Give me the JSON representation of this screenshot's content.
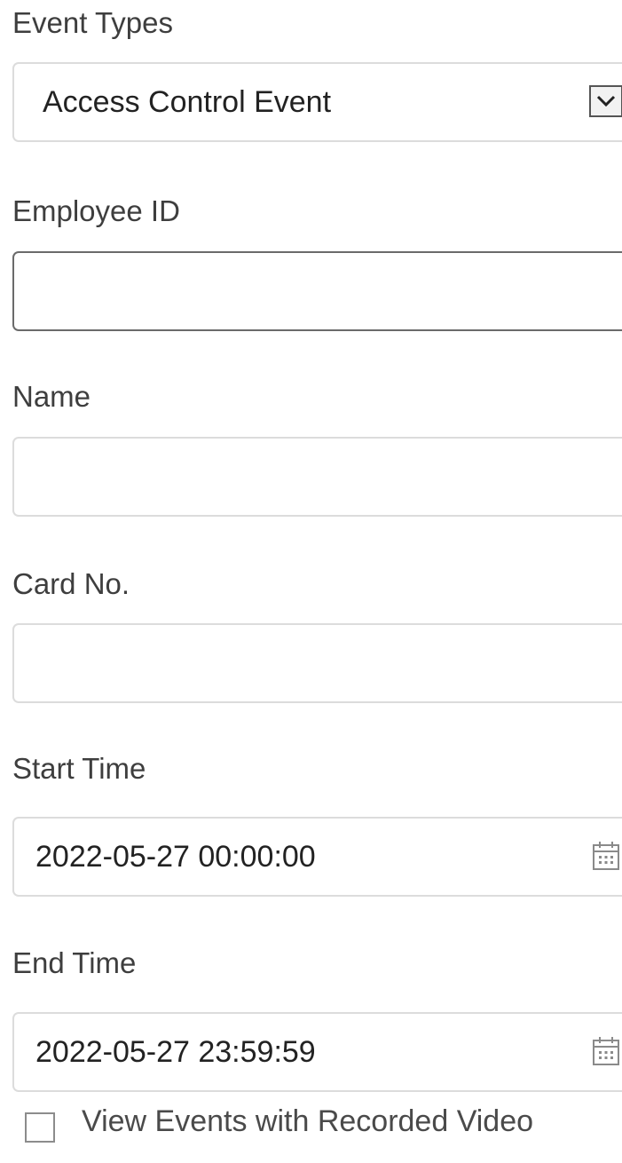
{
  "event_types": {
    "label": "Event Types",
    "selected": "Access Control Event",
    "icon": "chevron-down-icon"
  },
  "employee_id": {
    "label": "Employee ID",
    "value": ""
  },
  "name": {
    "label": "Name",
    "value": ""
  },
  "card_no": {
    "label": "Card No.",
    "value": ""
  },
  "start_time": {
    "label": "Start Time",
    "value": "2022-05-27 00:00:00",
    "icon": "calendar-icon"
  },
  "end_time": {
    "label": "End Time",
    "value": "2022-05-27 23:59:59",
    "icon": "calendar-icon"
  },
  "recorded_video": {
    "label": "View Events with Recorded Video",
    "checked": false
  }
}
